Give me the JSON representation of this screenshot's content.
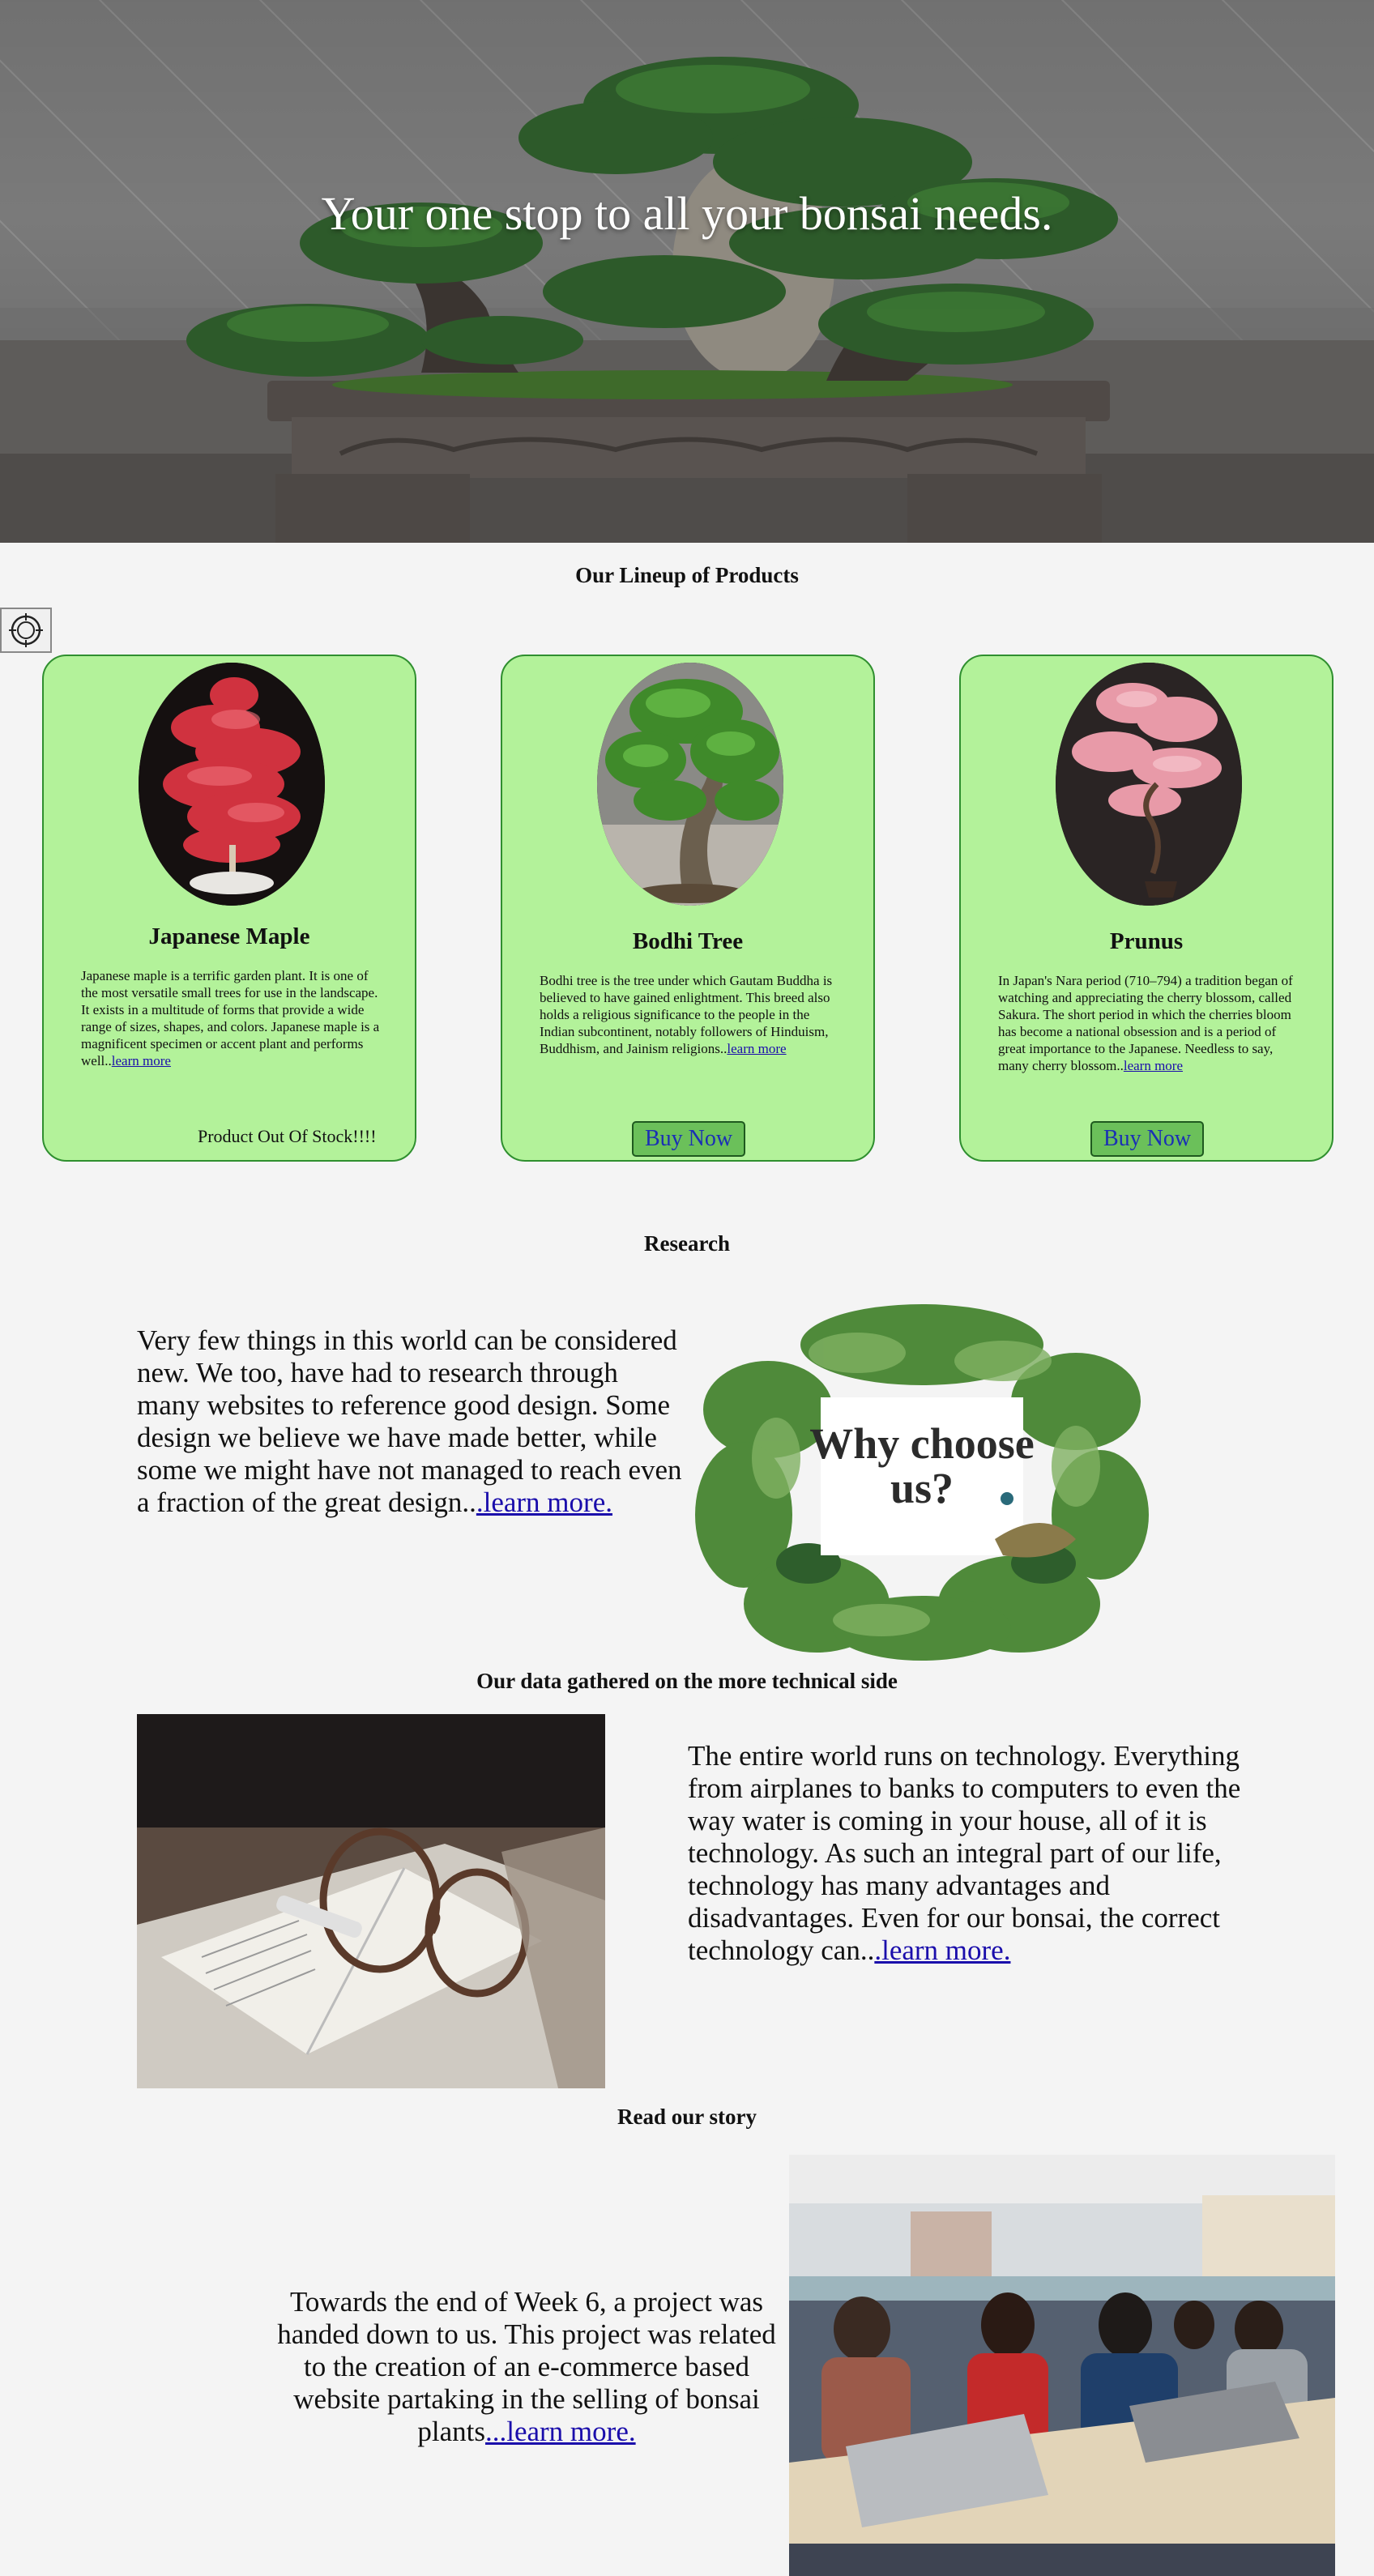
{
  "hero": {
    "title": "Your one stop to all your bonsai needs."
  },
  "lineup": {
    "heading": "Our Lineup of Products",
    "menu_icon": "circle-menu-icon",
    "products": [
      {
        "name": "Japanese Maple",
        "description": "Japanese maple is a terrific garden plant. It is one of the most versatile small trees for use in the landscape. It exists in a multitude of forms that provide a wide range of sizes, shapes, and colors. Japanese maple is a magnificent specimen or accent plant and performs well..",
        "link": "learn more",
        "status": "Product Out Of Stock!!!!"
      },
      {
        "name": "Bodhi Tree",
        "description": "Bodhi tree is the tree under which Gautam Buddha is believed to have gained enlightment. This breed also holds a religious significance to the people in the Indian subcontinent, notably followers of Hinduism, Buddhism, and Jainism religions..",
        "link": "learn more",
        "button": "Buy Now"
      },
      {
        "name": "Prunus",
        "description": "In Japan's Nara period (710–794) a tradition began of watching and appreciating the cherry blossom, called Sakura. The short period in which the cherries bloom has become a national obsession and is a period of great importance to the Japanese. Needless to say, many cherry blossom..",
        "link": "learn more",
        "button": "Buy Now"
      }
    ]
  },
  "research": {
    "heading": "Research",
    "text": "Very few things in this world can be considered new. We too, have had to research through many websites to reference good design. Some design we believe we have made better, while some we might have not managed to reach even a fraction of the great design..",
    "link": ".learn more.",
    "image_text_line1": "Why choose",
    "image_text_line2": "us?"
  },
  "technical": {
    "heading": "Our data gathered on the more technical side",
    "text": "The entire world runs on technology. Everything from airplanes to banks to computers to even the way water is coming in your house, all of it is technology. As such an integral part of our life, technology has many advantages and disadvantages. Even for our bonsai, the correct technology can..",
    "link": ".learn more."
  },
  "story": {
    "heading": "Read our story",
    "text": "Towards the end of Week 6, a project was handed down to us. This project was related to the creation of an e-commerce based website partaking in the selling of bonsai plants",
    "link": "...learn more."
  },
  "colors": {
    "card_bg": "#b3f29a",
    "card_border": "#2f8f2f",
    "button_bg": "#6bc05a",
    "link": "#1a0dab"
  }
}
